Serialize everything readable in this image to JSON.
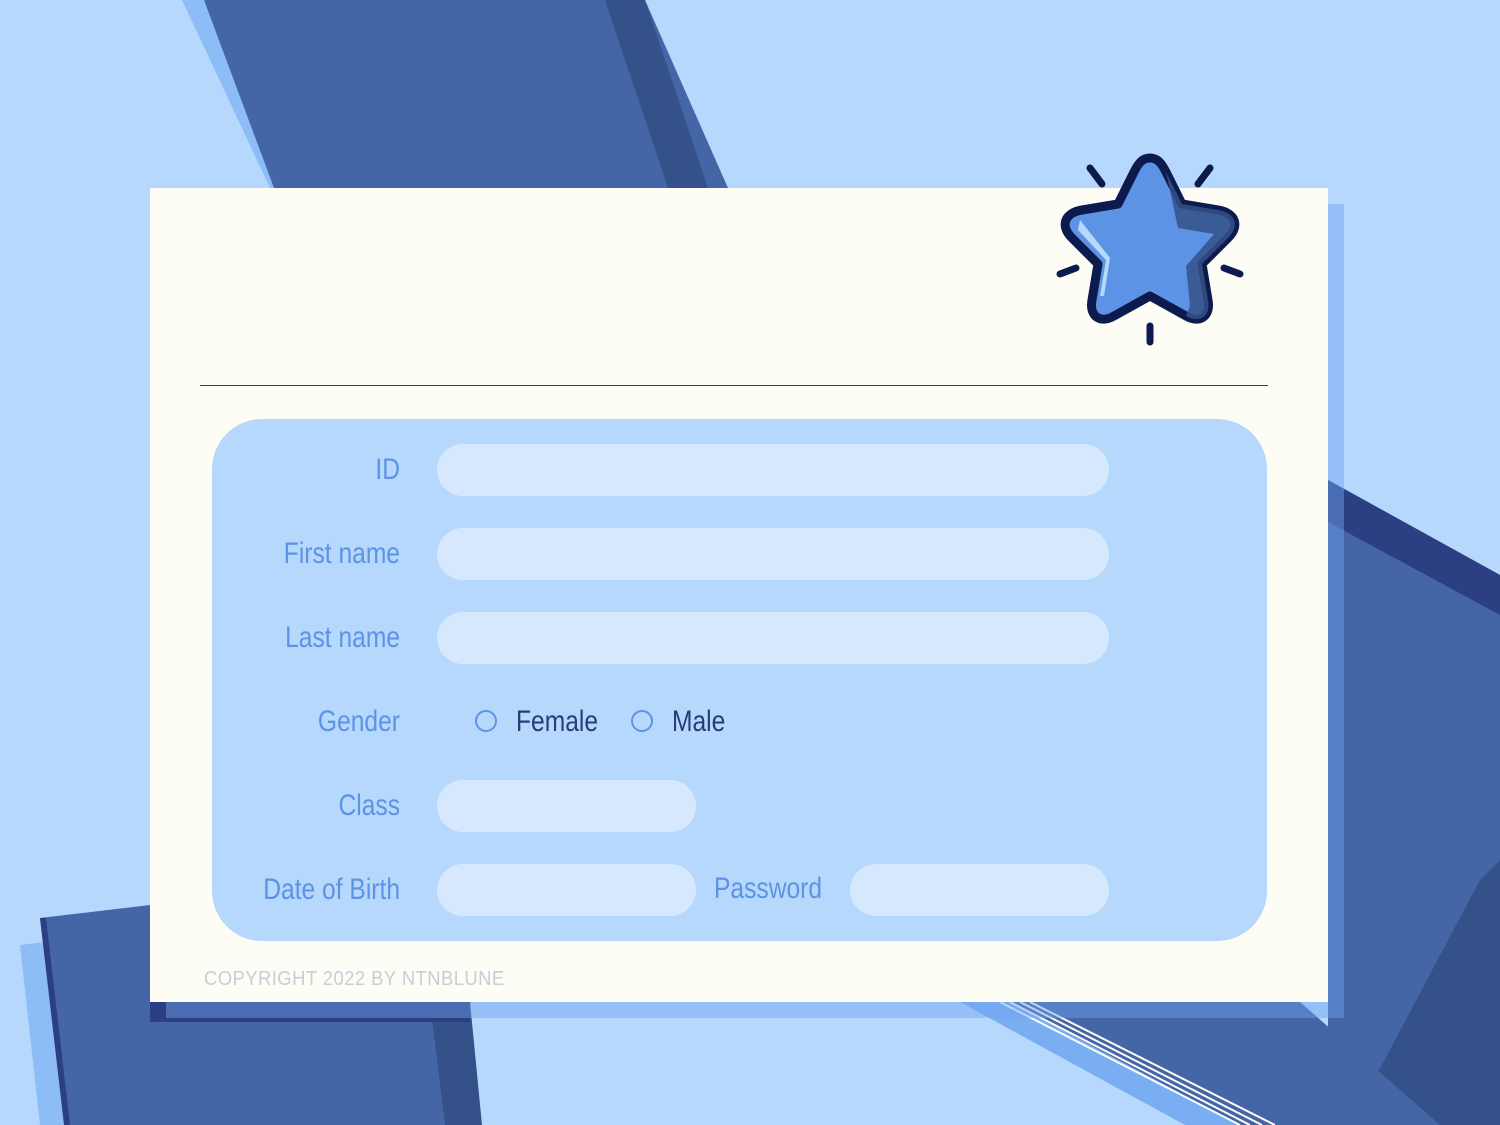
{
  "form": {
    "fields": {
      "id": {
        "label": "ID",
        "value": ""
      },
      "first_name": {
        "label": "First name",
        "value": ""
      },
      "last_name": {
        "label": "Last name",
        "value": ""
      },
      "class": {
        "label": "Class",
        "value": ""
      },
      "date_of_birth": {
        "label": "Date of Birth",
        "value": ""
      },
      "password": {
        "label": "Password",
        "value": ""
      }
    },
    "gender": {
      "label": "Gender",
      "options": [
        "Female",
        "Male"
      ]
    }
  },
  "footer": {
    "copyright": "COPYRIGHT 2022 BY NTNBLUNE"
  },
  "icons": {
    "decoration": "star-icon"
  },
  "colors": {
    "background": "#b6d8fd",
    "card": "#fdfdf6",
    "panel": "#b6d8fd",
    "input": "#d6e8fe",
    "label": "#5d93e4",
    "text_dark": "#283d78",
    "stripe_dark": "#4465a6"
  }
}
